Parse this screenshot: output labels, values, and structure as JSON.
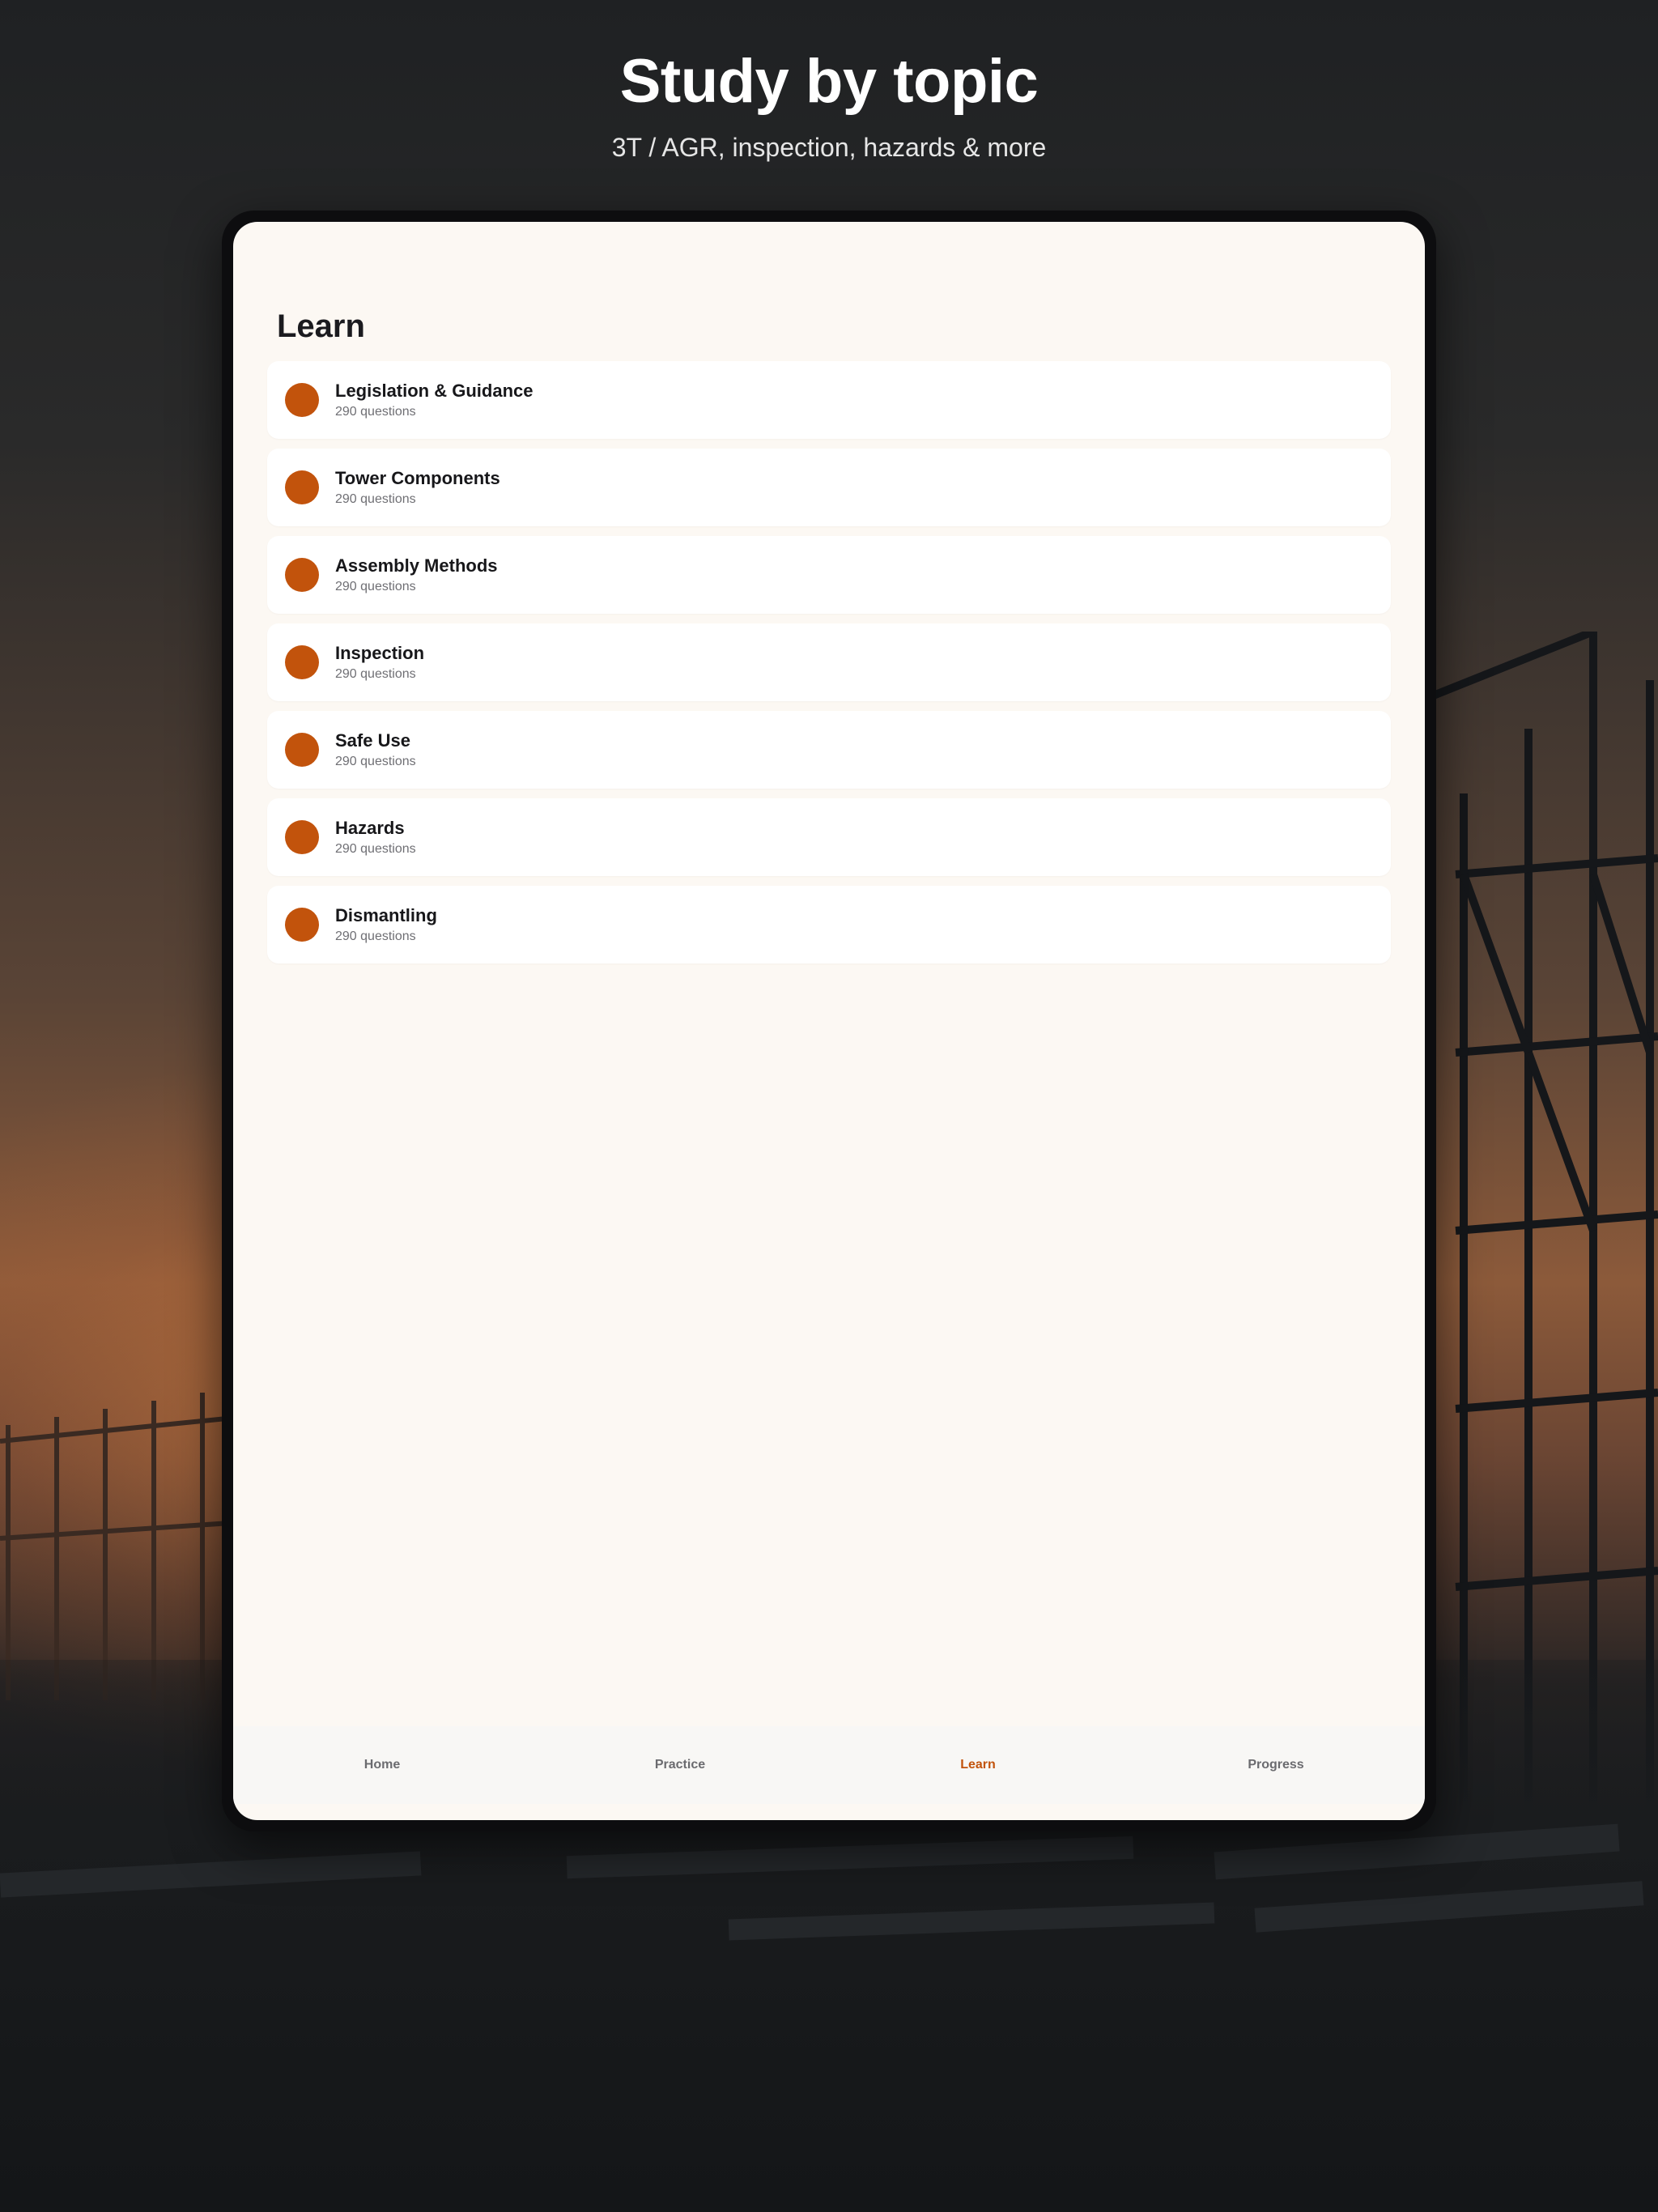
{
  "header": {
    "title": "Study by topic",
    "subtitle": "3T / AGR, inspection, hazards & more"
  },
  "screen": {
    "title": "Learn",
    "accent_color": "#c2530c",
    "topics": [
      {
        "name": "Legislation & Guidance",
        "count": "290 questions"
      },
      {
        "name": "Tower Components",
        "count": "290 questions"
      },
      {
        "name": "Assembly Methods",
        "count": "290 questions"
      },
      {
        "name": "Inspection",
        "count": "290 questions"
      },
      {
        "name": "Safe Use",
        "count": "290 questions"
      },
      {
        "name": "Hazards",
        "count": "290 questions"
      },
      {
        "name": "Dismantling",
        "count": "290 questions"
      }
    ]
  },
  "tabbar": {
    "tabs": [
      {
        "label": "Home",
        "active": false
      },
      {
        "label": "Practice",
        "active": false
      },
      {
        "label": "Learn",
        "active": true
      },
      {
        "label": "Progress",
        "active": false
      }
    ]
  }
}
